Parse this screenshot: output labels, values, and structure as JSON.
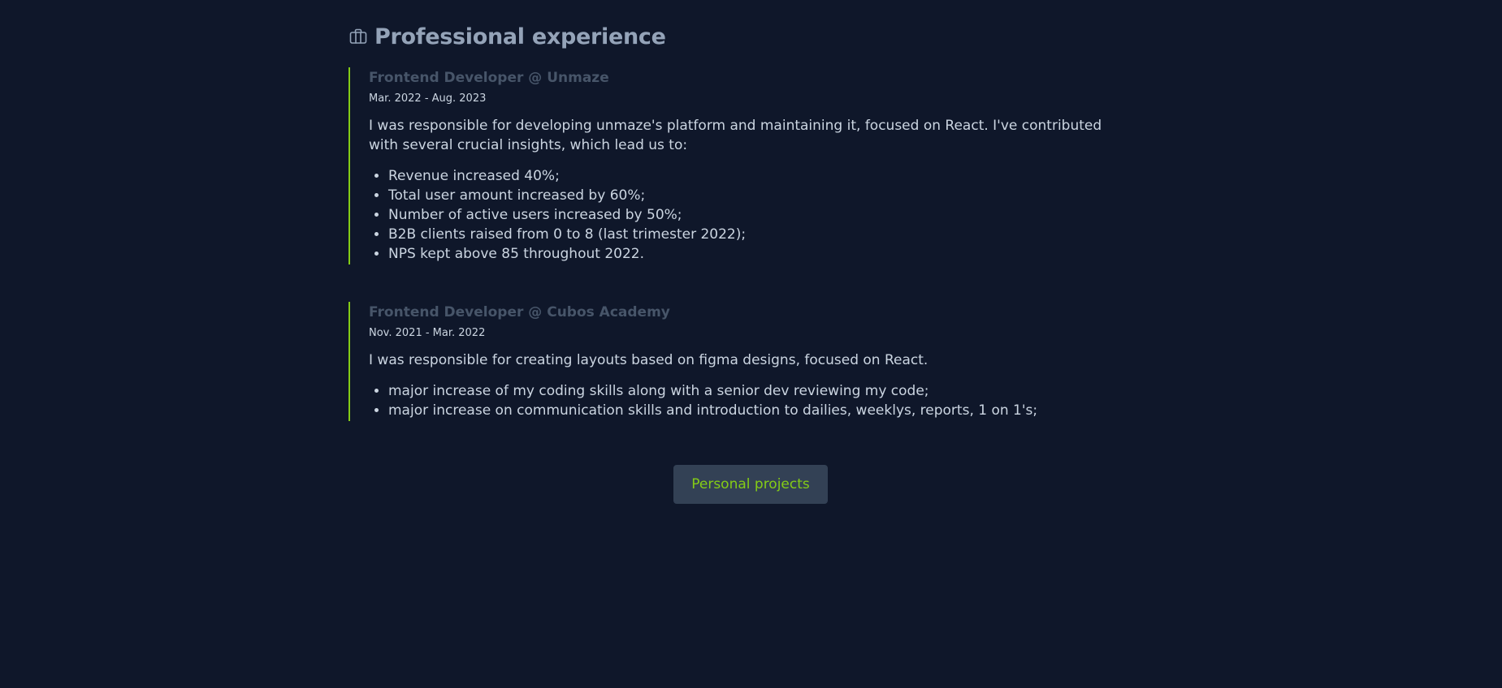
{
  "section": {
    "title": "Professional experience",
    "icon": "briefcase-icon"
  },
  "jobs": [
    {
      "title": "Frontend Developer @ Unmaze",
      "dates": "Mar. 2022 - Aug. 2023",
      "description": "I was responsible for developing unmaze's platform and maintaining it, focused on React. I've contributed with several crucial insights, which lead us to:",
      "bullets": [
        "Revenue increased 40%;",
        "Total user amount increased by 60%;",
        "Number of active users increased by 50%;",
        "B2B clients raised from 0 to 8 (last trimester 2022);",
        "NPS kept above 85 throughout 2022."
      ]
    },
    {
      "title": "Frontend Developer @ Cubos Academy",
      "dates": "Nov. 2021 - Mar. 2022",
      "description": "I was responsible for creating layouts based on figma designs, focused on React.",
      "bullets": [
        "major increase of my coding skills along with a senior dev reviewing my code;",
        "major increase on communication skills and introduction to dailies, weeklys, reports, 1 on 1's;"
      ]
    }
  ],
  "projects_button": {
    "label": "Personal projects"
  },
  "colors": {
    "background": "#0f172a",
    "accent": "#84cc16",
    "muted": "#475569",
    "text": "#cbd5e1",
    "heading": "#94a3b8"
  }
}
